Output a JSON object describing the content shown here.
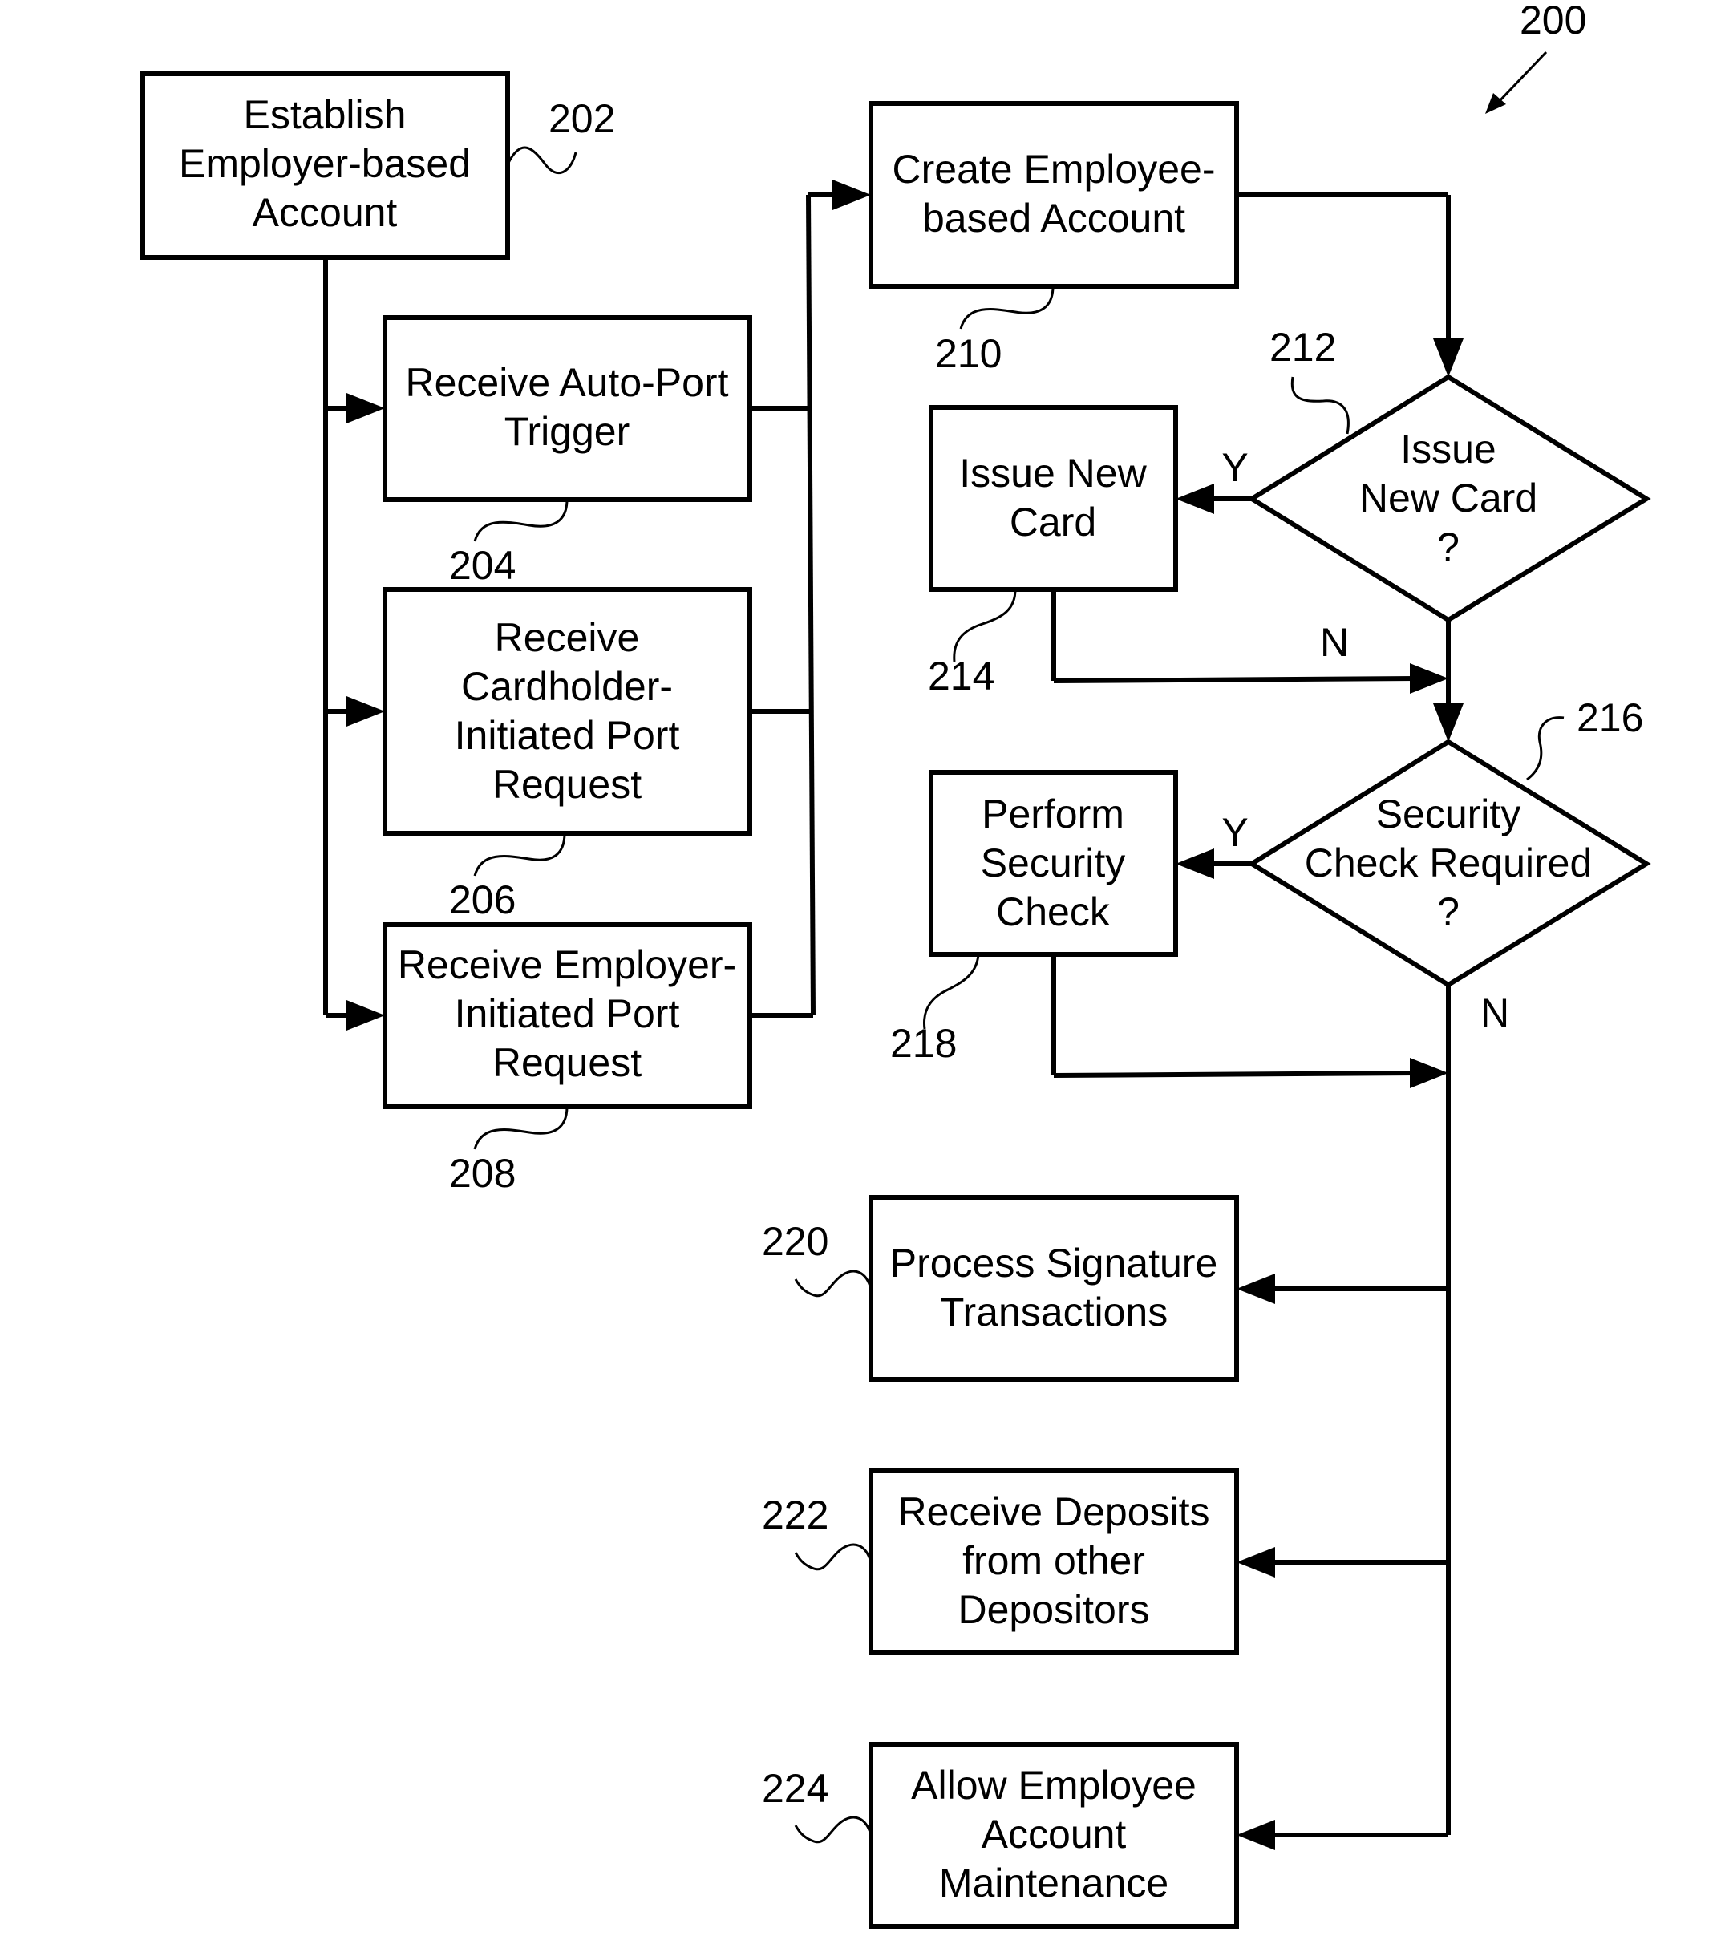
{
  "figure": {
    "ref": "200",
    "nodes": [
      {
        "id": "202",
        "type": "process",
        "lines": [
          "Establish",
          "Employer-based",
          "Account"
        ]
      },
      {
        "id": "204",
        "type": "process",
        "lines": [
          "Receive Auto-Port",
          "Trigger"
        ]
      },
      {
        "id": "206",
        "type": "process",
        "lines": [
          "Receive",
          "Cardholder-",
          "Initiated Port",
          "Request"
        ]
      },
      {
        "id": "208",
        "type": "process",
        "lines": [
          "Receive Employer-",
          "Initiated Port",
          "Request"
        ]
      },
      {
        "id": "210",
        "type": "process",
        "lines": [
          "Create Employee-",
          "based Account"
        ]
      },
      {
        "id": "212",
        "type": "decision",
        "lines": [
          "Issue",
          "New Card",
          "?"
        ]
      },
      {
        "id": "214",
        "type": "process",
        "lines": [
          "Issue New",
          "Card"
        ]
      },
      {
        "id": "216",
        "type": "decision",
        "lines": [
          "Security",
          "Check Required",
          "?"
        ]
      },
      {
        "id": "218",
        "type": "process",
        "lines": [
          "Perform",
          "Security",
          "Check"
        ]
      },
      {
        "id": "220",
        "type": "process",
        "lines": [
          "Process Signature",
          "Transactions"
        ]
      },
      {
        "id": "222",
        "type": "process",
        "lines": [
          "Receive Deposits",
          "from other",
          "Depositors"
        ]
      },
      {
        "id": "224",
        "type": "process",
        "lines": [
          "Allow Employee",
          "Account",
          "Maintenance"
        ]
      }
    ],
    "edge_labels": {
      "d212_yes": "Y",
      "d212_no": "N",
      "d216_yes": "Y",
      "d216_no": "N"
    }
  }
}
